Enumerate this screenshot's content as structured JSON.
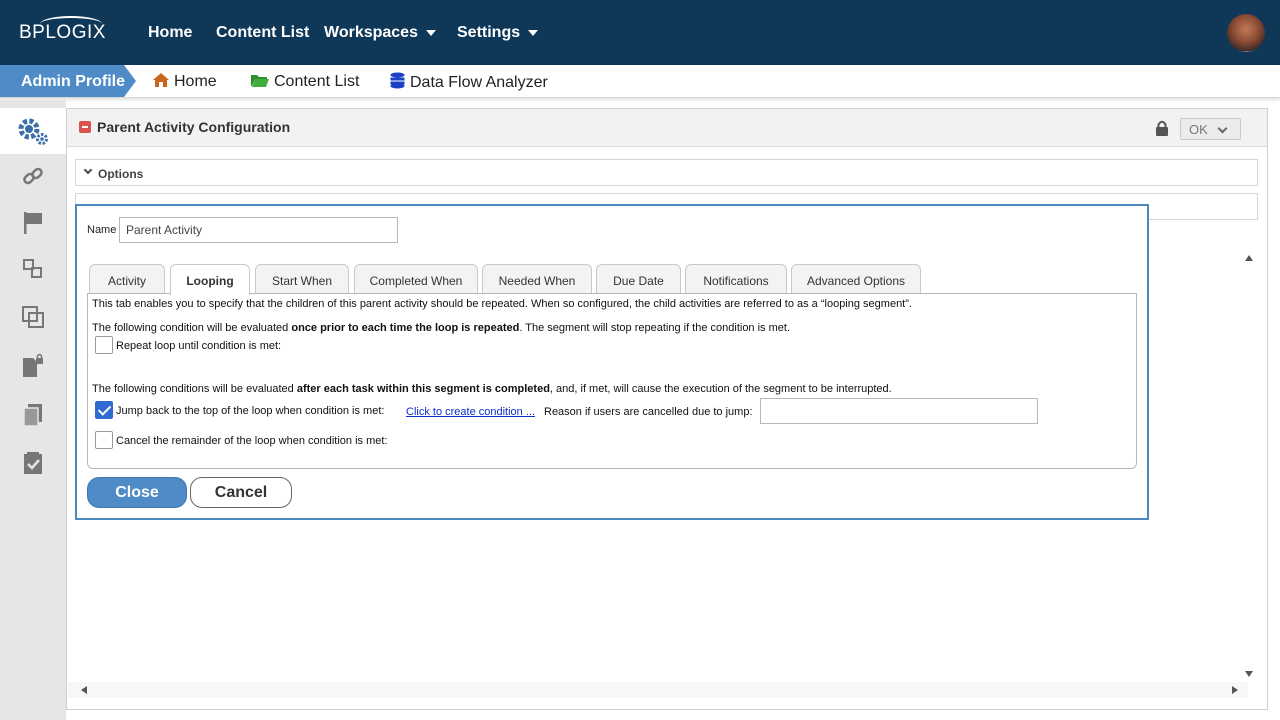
{
  "app": {
    "logo": "BPLOGIX"
  },
  "topnav": {
    "home": "Home",
    "content_list": "Content List",
    "workspaces": "Workspaces",
    "settings": "Settings"
  },
  "breadcrumb": {
    "profile": "Admin Profile",
    "home": "Home",
    "content_list": "Content List",
    "data_flow": "Data Flow Analyzer"
  },
  "colors": {
    "topbar": "#0f3858",
    "accent": "#4f8bc7",
    "dialog_border": "#4e88bf",
    "link": "#0b2fc8",
    "checkbox_checked": "#2f6ad0"
  },
  "panel": {
    "title": "Parent Activity Configuration",
    "ok_label": "OK",
    "options_label": "Options"
  },
  "dialog": {
    "name_label": "Name",
    "name_value": "Parent Activity",
    "tabs": [
      {
        "label": "Activity",
        "active": false
      },
      {
        "label": "Looping",
        "active": true
      },
      {
        "label": "Start When",
        "active": false
      },
      {
        "label": "Completed When",
        "active": false
      },
      {
        "label": "Needed When",
        "active": false
      },
      {
        "label": "Due Date",
        "active": false
      },
      {
        "label": "Notifications",
        "active": false
      },
      {
        "label": "Advanced Options",
        "active": false
      }
    ],
    "intro": "This tab enables you to specify that the children of this parent activity should be repeated. When so configured, the child activities are referred to as a “looping segment”.",
    "cond1_pre": "The following condition will be evaluated ",
    "cond1_bold": "once prior to each time the loop is repeated",
    "cond1_post": ". The segment will stop repeating if the condition is met.",
    "repeat_label": "Repeat loop until condition is met:",
    "repeat_checked": false,
    "cond2_pre": "The following conditions will be evaluated ",
    "cond2_bold": "after each task within this segment is completed",
    "cond2_post": ", and, if met, will cause the execution of the segment to be interrupted.",
    "jump_label": "Jump back to the top of the loop when condition is met:",
    "jump_checked": true,
    "create_condition_link": "Click to create condition ...",
    "reason_label": "Reason if users are cancelled due to jump:",
    "reason_value": "",
    "cancel_remainder_label": "Cancel the remainder of the loop when condition is met:",
    "cancel_remainder_checked": false,
    "close_label": "Close",
    "cancel_label": "Cancel"
  }
}
